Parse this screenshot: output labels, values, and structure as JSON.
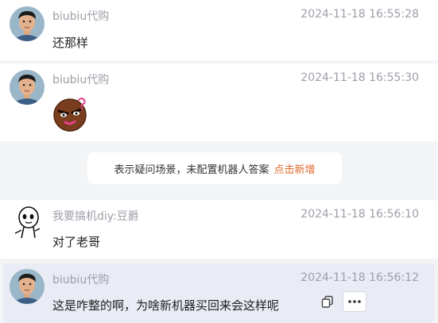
{
  "messages": [
    {
      "sender": "biubiu代购",
      "time": "2024-11-18 16:55:28",
      "text": "还那样"
    },
    {
      "sender": "biubiu代购",
      "time": "2024-11-18 16:55:30",
      "sticker": "confused-emoji-sticker"
    },
    {
      "sender": "我要搞机diy:豆爵",
      "time": "2024-11-18 16:56:10",
      "text": "对了老哥"
    },
    {
      "sender": "biubiu代购",
      "time": "2024-11-18 16:56:12",
      "text": "这是咋整的啊，为啥新机器买回来会这样呢"
    }
  ],
  "system_notice": {
    "text": "表示疑问场景，未配置机器人答案",
    "link": "点击新增"
  },
  "message_actions": {
    "copy_icon": "copy-icon",
    "more_icon": "more-icon"
  },
  "colors": {
    "background": "#f3f4f6",
    "bubble": "#ffffff",
    "highlight": "#e9ebf5",
    "meta_text": "#9ca0a8",
    "link": "#e06a2c"
  }
}
